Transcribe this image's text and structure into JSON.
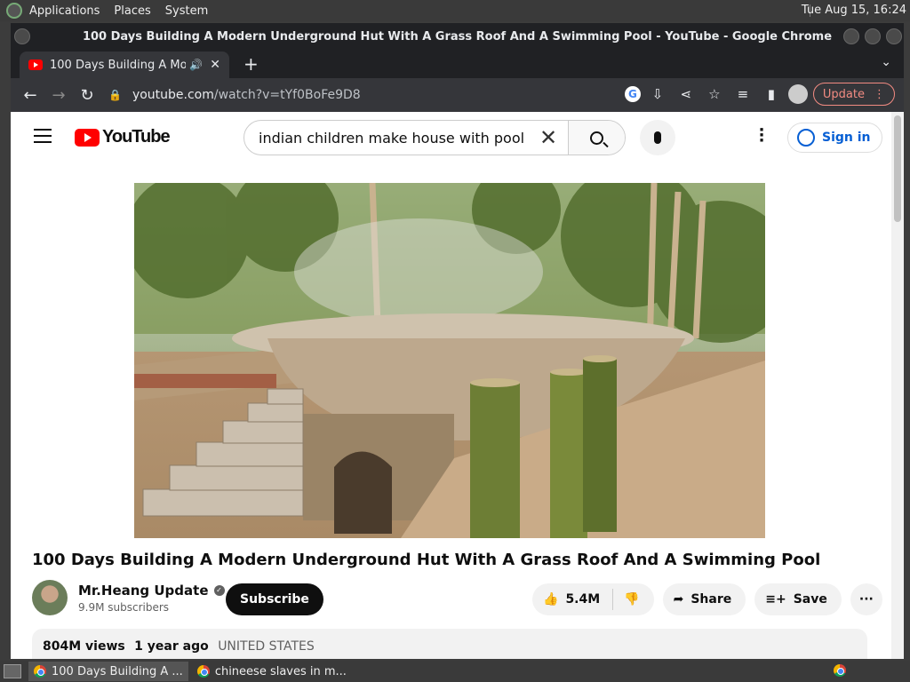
{
  "system_panel": {
    "menus": [
      "Applications",
      "Places",
      "System"
    ],
    "clock": "Tue Aug 15, 16:24"
  },
  "window": {
    "title": "100 Days Building A Modern Underground Hut With A Grass Roof And A Swimming Pool - YouTube - Google Chrome"
  },
  "tab": {
    "title": "100 Days Building A Moder",
    "close": "✕",
    "audio": "🔊"
  },
  "omnibox": {
    "host": "youtube.com",
    "path": "/watch?v=tYf0BoFe9D8"
  },
  "toolbar": {
    "update_label": "Update"
  },
  "youtube": {
    "logo_text": "YouTube",
    "search_query": "indian children make house with pool",
    "signin_label": "Sign in"
  },
  "video": {
    "title": "100 Days Building A Modern Underground Hut With A Grass Roof And A Swimming Pool",
    "channel": "Mr.Heang Update",
    "subscribers": "9.9M subscribers",
    "subscribe_label": "Subscribe",
    "likes": "5.4M",
    "share_label": "Share",
    "save_label": "Save",
    "views": "804M views",
    "age": "1 year ago",
    "country": "UNITED STATES"
  },
  "taskbar": {
    "tasks": [
      "100 Days Building A ...",
      "chineese slaves in m..."
    ]
  },
  "colors": {
    "yt_red": "#ff0000",
    "signin_blue": "#065fd4",
    "update_red": "#f28b82"
  }
}
